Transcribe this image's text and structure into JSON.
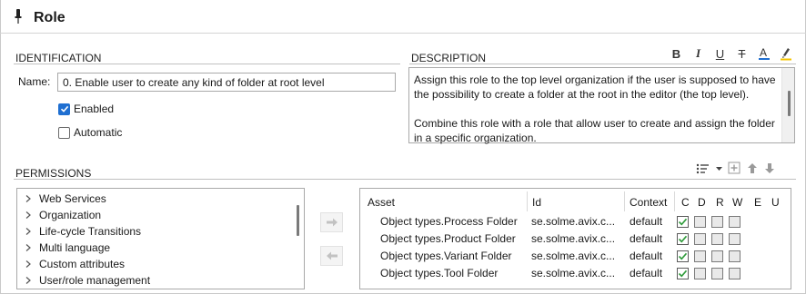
{
  "header": {
    "title": "Role",
    "icon": "pin-icon"
  },
  "identification": {
    "section_label": "IDENTIFICATION",
    "name_label": "Name:",
    "name_value": "0. Enable user to create any kind of folder at root level",
    "enabled_label": "Enabled",
    "enabled_checked": true,
    "automatic_label": "Automatic",
    "automatic_checked": false
  },
  "description": {
    "section_label": "DESCRIPTION",
    "paragraph_1": "Assign this role to the top level organization if the user is supposed to have the possibility to create a folder at the root in the editor (the top level).",
    "paragraph_2": "Combine this role with a role that allow user to create and assign the folder in a specific organization.",
    "toolbar": [
      {
        "name": "bold-icon",
        "glyph": "B"
      },
      {
        "name": "italic-icon",
        "glyph": "I"
      },
      {
        "name": "underline-icon",
        "glyph": "U"
      },
      {
        "name": "strikethrough-icon",
        "glyph": "T"
      },
      {
        "name": "font-color-icon",
        "glyph": "A"
      },
      {
        "name": "highlight-icon",
        "glyph": ""
      }
    ]
  },
  "permissions": {
    "section_label": "PERMISSIONS",
    "toolbar": [
      "sort-icon",
      "dropdown-arrow-icon",
      "add-icon",
      "move-up-icon",
      "move-down-icon"
    ],
    "tree_items": [
      "Web Services",
      "Organization",
      "Life-cycle Transitions",
      "Multi language",
      "Custom attributes",
      "User/role management"
    ],
    "columns": {
      "asset": "Asset",
      "id": "Id",
      "context": "Context",
      "c": "C",
      "d": "D",
      "r": "R",
      "w": "W",
      "e": "E",
      "u": "U"
    },
    "rows": [
      {
        "asset": "Object types.Process Folder",
        "id": "se.solme.avix.c...",
        "context": "default",
        "c": true,
        "d": false,
        "r": false,
        "w": false
      },
      {
        "asset": "Object types.Product Folder",
        "id": "se.solme.avix.c...",
        "context": "default",
        "c": true,
        "d": false,
        "r": false,
        "w": false
      },
      {
        "asset": "Object types.Variant Folder",
        "id": "se.solme.avix.c...",
        "context": "default",
        "c": true,
        "d": false,
        "r": false,
        "w": false
      },
      {
        "asset": "Object types.Tool Folder",
        "id": "se.solme.avix.c...",
        "context": "default",
        "c": true,
        "d": false,
        "r": false,
        "w": false
      }
    ]
  },
  "colors": {
    "accent": "#1f6fd1",
    "check_green": "#2e9b3a",
    "font_color_bar": "#1f6fd1",
    "highlight_bar": "#f5c400"
  }
}
